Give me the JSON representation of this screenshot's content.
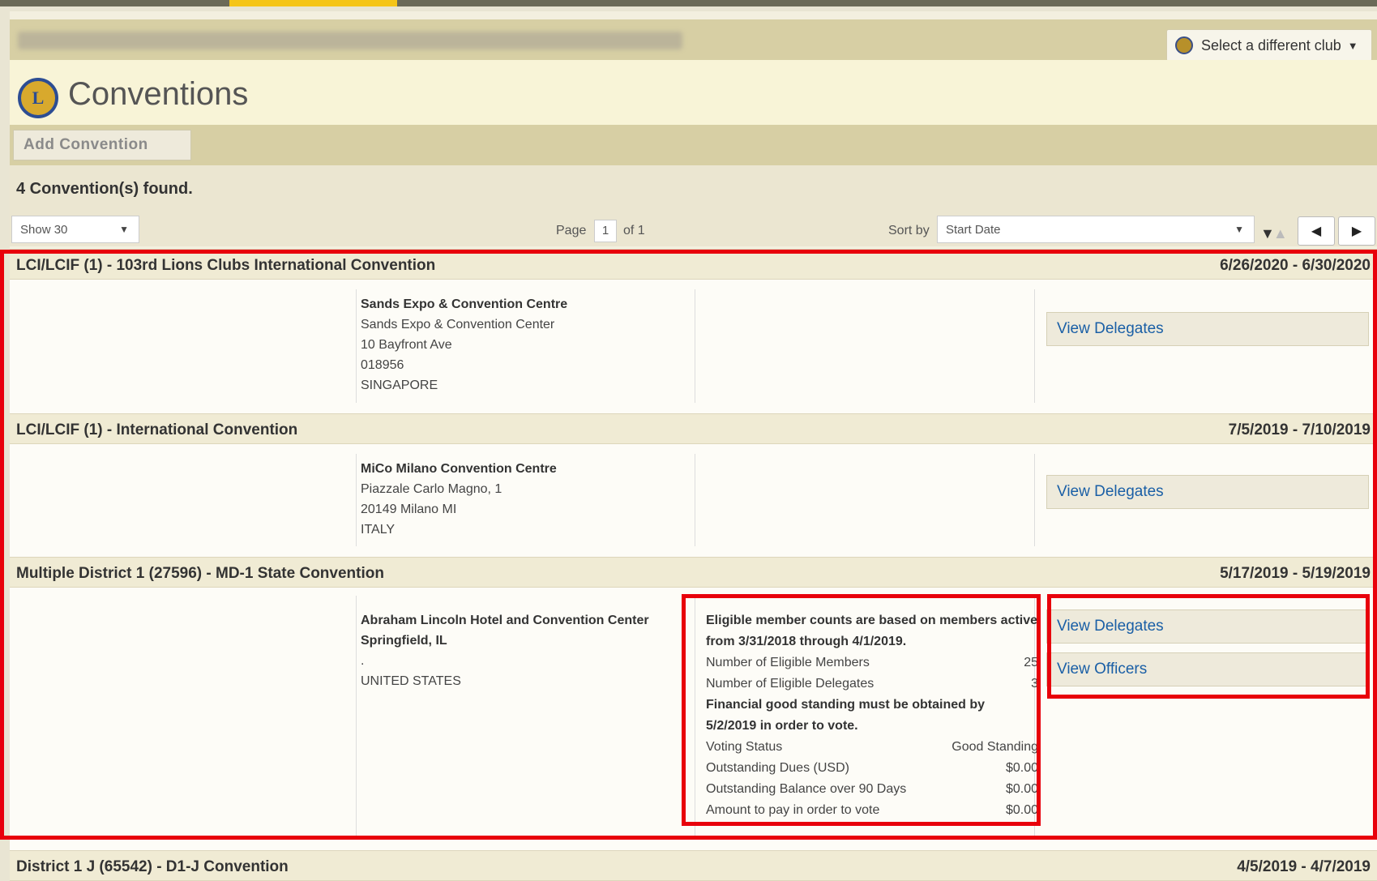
{
  "header": {
    "select_club_label": "Select a different club",
    "page_title": "Conventions",
    "add_button": "Add Convention"
  },
  "results": {
    "found_text": "4 Convention(s) found.",
    "show_select": "Show 30",
    "page_label": "Page",
    "page_value": "1",
    "page_of": "of 1",
    "sort_label": "Sort by",
    "sort_select": "Start Date",
    "prev_icon": "◀",
    "next_icon": "▶"
  },
  "conventions": [
    {
      "name": "LCI/LCIF (1) - 103rd Lions Clubs International Convention",
      "dates": "6/26/2020 - 6/30/2020",
      "venue": "Sands Expo & Convention Centre",
      "address": [
        "Sands Expo & Convention Center",
        "10 Bayfront Ave",
        "018956",
        "SINGAPORE"
      ],
      "actions": [
        "View Delegates"
      ]
    },
    {
      "name": "LCI/LCIF (1) - International Convention",
      "dates": "7/5/2019 - 7/10/2019",
      "venue": "MiCo Milano Convention Centre",
      "address": [
        "Piazzale Carlo Magno, 1",
        "20149 Milano MI",
        "ITALY"
      ],
      "actions": [
        "View Delegates"
      ]
    },
    {
      "name": "Multiple District 1 (27596) - MD-1 State Convention",
      "dates": "5/17/2019 - 5/19/2019",
      "venue": "Abraham Lincoln Hotel and Convention Center",
      "venue2": "Springfield, IL",
      "address": [
        ".",
        "UNITED STATES"
      ],
      "actions": [
        "View Delegates",
        "View Officers"
      ],
      "eligibility": {
        "note1": "Eligible member counts are based on members active from 3/31/2018 through 4/1/2019.",
        "rows1": [
          {
            "label": "Number of Eligible Members",
            "value": "25"
          },
          {
            "label": "Number of Eligible Delegates",
            "value": "3"
          }
        ],
        "note2": "Financial good standing must be obtained by 5/2/2019 in order to vote.",
        "rows2": [
          {
            "label": "Voting Status",
            "value": "Good Standing"
          },
          {
            "label": "Outstanding Dues (USD)",
            "value": "$0.00"
          },
          {
            "label": "Outstanding Balance over 90 Days",
            "value": "$0.00"
          },
          {
            "label": "Amount to pay in order to vote",
            "value": "$0.00"
          }
        ]
      }
    },
    {
      "name": "District 1 J (65542) - D1-J Convention",
      "dates": "4/5/2019 - 4/7/2019"
    }
  ],
  "colors": {
    "accent_yellow": "#f5c518",
    "highlight_red": "#e8000b",
    "link_blue": "#1a5fa6"
  },
  "icons": [
    "lions-emblem-icon",
    "chevron-down-icon",
    "sort-desc-icon",
    "prev-page-icon",
    "next-page-icon"
  ]
}
